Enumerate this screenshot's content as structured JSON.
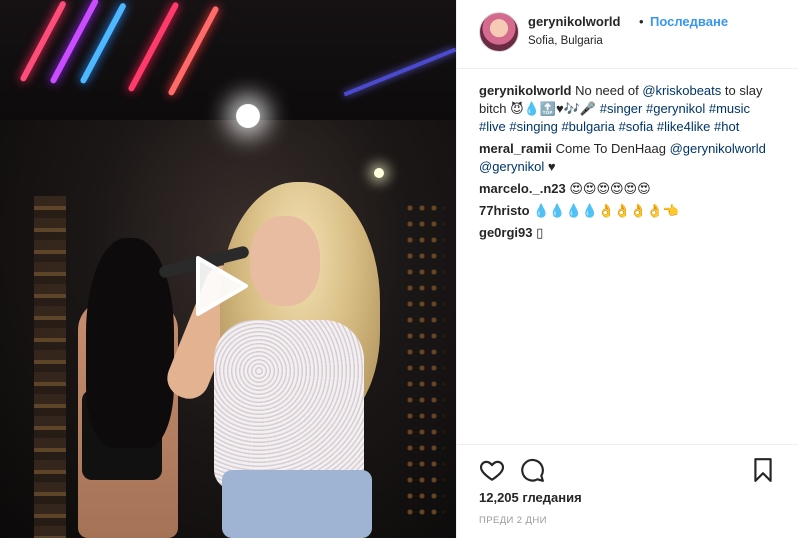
{
  "post": {
    "username": "gerynikolworld",
    "dot": "•",
    "follow_label": "Последване",
    "location": "Sofia, Bulgaria"
  },
  "caption": {
    "user": "gerynikolworld",
    "text": "No need of",
    "mention": "@kriskobeats",
    "text2": "to slay bitch 😈💧🔝♥🎶🎤",
    "hashtags": [
      "#singer",
      "#gerynikol",
      "#music",
      "#live",
      "#singing",
      "#bulgaria",
      "#sofia",
      "#like4like",
      "#hot"
    ]
  },
  "comments": [
    {
      "user": "meral_ramii",
      "text": "Come To DenHaag",
      "mentions": [
        "@gerynikolworld",
        "@gerynikol"
      ],
      "suffix": "♥"
    },
    {
      "user": "marcelo._.n23",
      "text": "😍😍😍😍😍😍"
    },
    {
      "user": "77hristo",
      "text": "💧💧💧💧👌👌👌👌👈"
    },
    {
      "user": "ge0rgi93",
      "text": "▯"
    }
  ],
  "stats": {
    "views": "12,205 гледания",
    "time_ago": "ПРЕДИ 2 ДНИ"
  },
  "icons": {
    "play": "play-icon",
    "heart": "heart-icon",
    "comment": "comment-icon",
    "save": "bookmark-icon"
  },
  "colors": {
    "link": "#003569",
    "follow": "#3897f0",
    "text": "#262626",
    "muted": "#999999"
  }
}
